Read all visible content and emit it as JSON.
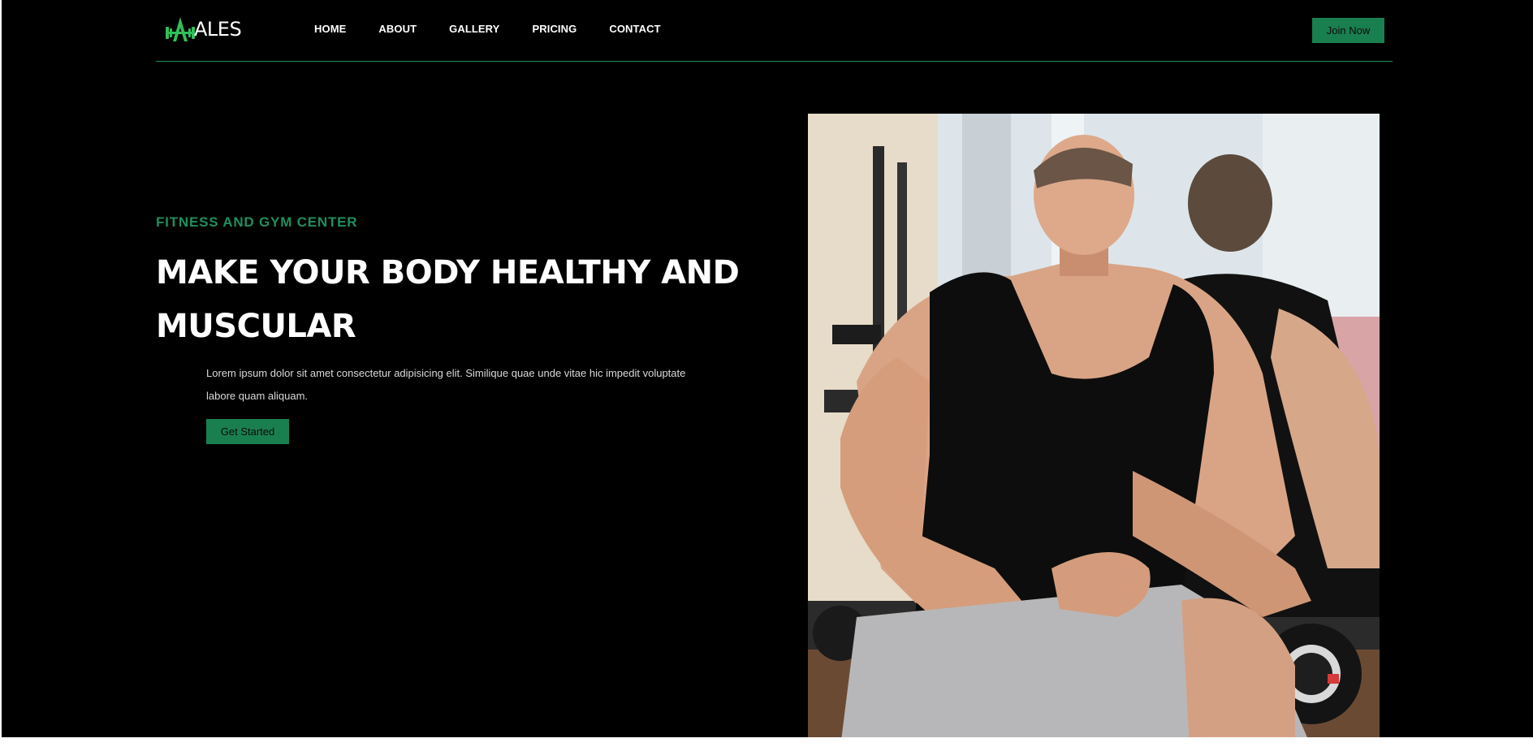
{
  "brand": {
    "name": "ALES",
    "icon": "dumbbell-a-logo-icon",
    "accent": "#2fbf5a"
  },
  "nav": {
    "items": [
      {
        "label": "HOME"
      },
      {
        "label": "ABOUT"
      },
      {
        "label": "GALLERY"
      },
      {
        "label": "PRICING"
      },
      {
        "label": "CONTACT"
      }
    ]
  },
  "header": {
    "join_label": "Join Now"
  },
  "hero": {
    "eyebrow": "FITNESS AND GYM CENTER",
    "title": "MAKE YOUR BODY HEALTHY AND MUSCULAR",
    "text": "Lorem ipsum dolor sit amet consectetur adipisicing elit. Similique quae unde vitae hic impedit voluptate labore quam aliquam.",
    "cta_label": "Get Started",
    "image": "muscular-man-with-dumbbells-photo"
  },
  "colors": {
    "background": "#000000",
    "primary": "#1a7f4f",
    "accent_text": "#1f8f5c"
  }
}
